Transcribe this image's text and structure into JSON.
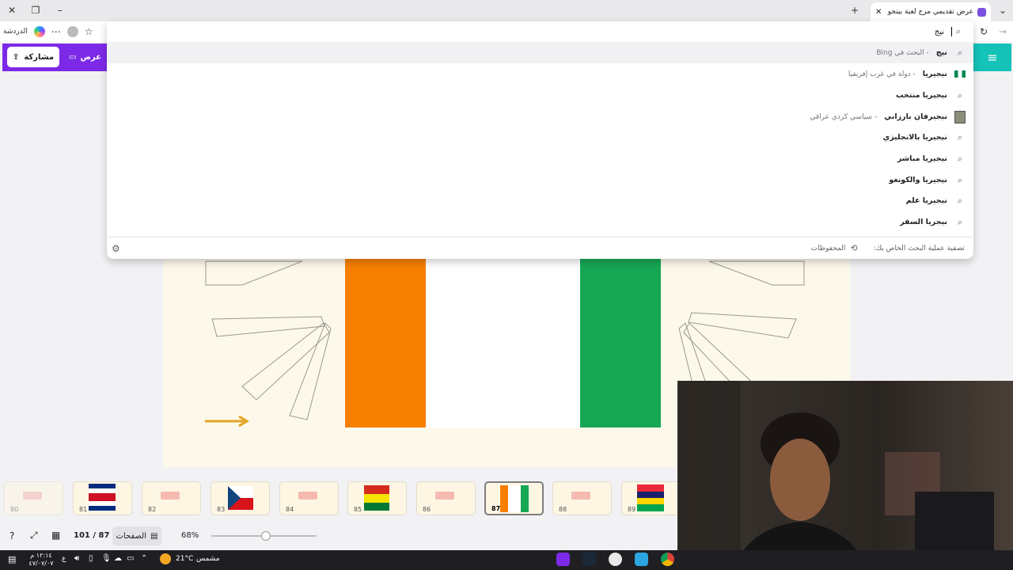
{
  "browser": {
    "tab_title": "عرض تقديمي مرج لعبة بينجو عربي",
    "left_label": "الدردشة",
    "omnibox_query": "نيج"
  },
  "suggestions": [
    {
      "title": "نيج",
      "subtitle": "- البحث في Bing",
      "icon": "search-icon",
      "highlighted": true
    },
    {
      "title": "نيجيريا",
      "subtitle": "- دولة في غرب إفريقيا",
      "icon": "nigeria-flag-icon"
    },
    {
      "title": "نيجيريا منتخب",
      "subtitle": "",
      "icon": "search-icon"
    },
    {
      "title": "نيجيرفان بارزاني",
      "subtitle": "- سياسي كردي عراقي",
      "icon": "person-thumbnail-icon"
    },
    {
      "title": "نيجيريا بالانجليزي",
      "subtitle": "",
      "icon": "search-icon"
    },
    {
      "title": "نيجيريا مباشر",
      "subtitle": "",
      "icon": "search-icon"
    },
    {
      "title": "نيجيريا والكونغو",
      "subtitle": "",
      "icon": "search-icon"
    },
    {
      "title": "نيجيريا علم",
      "subtitle": "",
      "icon": "search-icon"
    },
    {
      "title": "نيجريا السفر",
      "subtitle": "",
      "icon": "search-icon"
    }
  ],
  "suggest_footer": {
    "label": "تصفية عملية البحث الخاص بك:",
    "history": "المحفوظات"
  },
  "editor": {
    "share_label": "مشاركة",
    "present_label": "عرض",
    "accent": "#7d2ae8",
    "menu_color": "#14c2b8"
  },
  "thumbnails": [
    {
      "num": "80"
    },
    {
      "num": "81"
    },
    {
      "num": "82"
    },
    {
      "num": "83"
    },
    {
      "num": "84"
    },
    {
      "num": "85"
    },
    {
      "num": "86"
    },
    {
      "num": "87",
      "selected": true
    },
    {
      "num": "88"
    },
    {
      "num": "89"
    }
  ],
  "bottombar": {
    "page_counter": "101 / 87",
    "pages_label": "الصفحات",
    "zoom": "68%",
    "zoom_fraction": 0.68
  },
  "taskbar": {
    "time": "١٢:١٤ م",
    "date": "٤٧/٠٧/٠٧",
    "lang": "ع",
    "weather": "21°C",
    "weather_label": "مشمس"
  }
}
